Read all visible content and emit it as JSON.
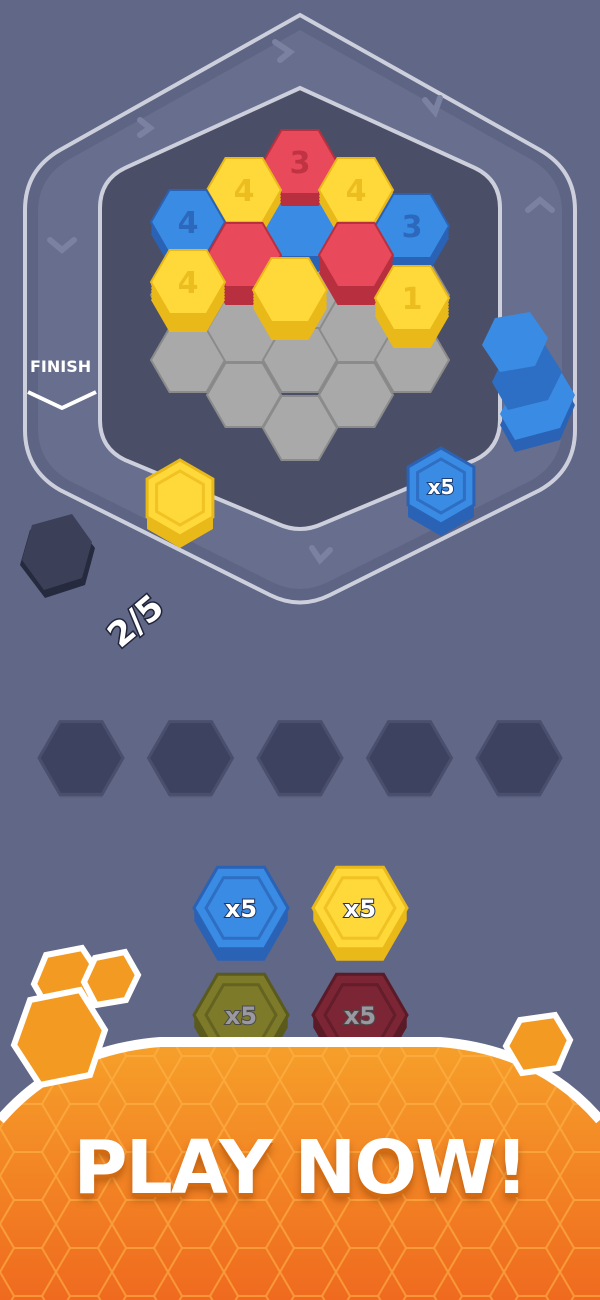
{
  "colors": {
    "background": "#606787",
    "yellow": "#ffd83a",
    "blue": "#3a8be4",
    "red": "#e8495b",
    "gray": "#a9a9a9",
    "orange": "#f29620"
  },
  "board": {
    "finish_label": "FINISH",
    "progress_label": "2/5",
    "tiles": [
      {
        "color": "red",
        "number": "3"
      },
      {
        "color": "yellow",
        "number": "4"
      },
      {
        "color": "yellow",
        "number": "4"
      },
      {
        "color": "blue",
        "number": "4"
      },
      {
        "color": "blue",
        "number": "3"
      },
      {
        "color": "yellow",
        "number": "4"
      },
      {
        "color": "yellow",
        "number": "1"
      }
    ],
    "track_pieces": [
      {
        "color": "yellow",
        "label": ""
      },
      {
        "color": "blue",
        "label": "x5"
      }
    ]
  },
  "slots": {
    "count": 5
  },
  "pieces": [
    {
      "color": "blue",
      "label": "x5",
      "active": true
    },
    {
      "color": "yellow",
      "label": "x5",
      "active": true
    },
    {
      "color": "yellow",
      "label": "x5",
      "active": false
    },
    {
      "color": "red",
      "label": "x5",
      "active": false
    }
  ],
  "cta": {
    "label": "PLAY NOW!"
  }
}
